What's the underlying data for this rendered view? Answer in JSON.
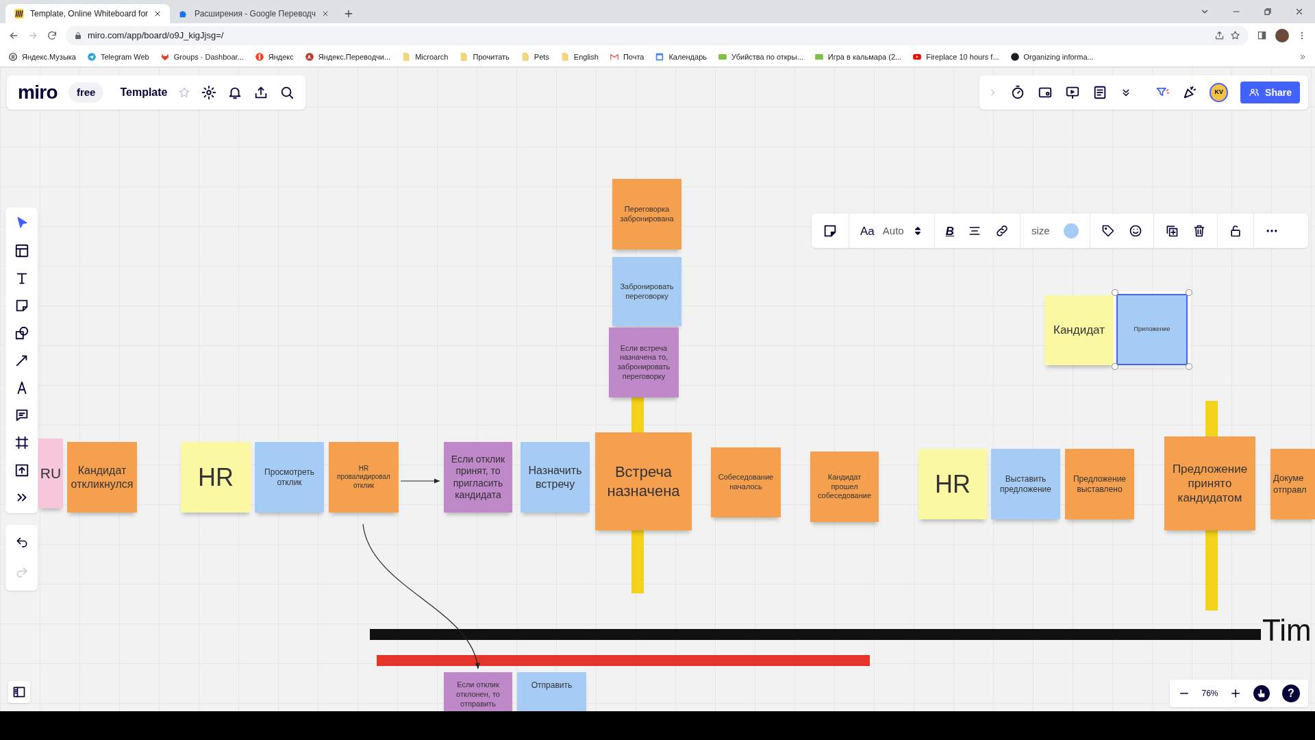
{
  "browser": {
    "tabs": [
      {
        "title": "Template, Online Whiteboard for",
        "selected": true,
        "kind": "miro"
      },
      {
        "title": "Расширения - Google Переводч",
        "selected": false,
        "kind": "puzzle"
      }
    ],
    "address": "miro.com/app/board/o9J_kigJjsg=/",
    "bookmarks": [
      {
        "label": "Яндекс.Музыка",
        "kind": "music"
      },
      {
        "label": "Telegram Web",
        "kind": "telegram"
      },
      {
        "label": "Groups · Dashboar...",
        "kind": "gitlab"
      },
      {
        "label": "Яндекс",
        "kind": "yandex"
      },
      {
        "label": "Яндекс.Переводчи...",
        "kind": "translate"
      },
      {
        "label": "Microarch",
        "kind": "folder"
      },
      {
        "label": "Прочитать",
        "kind": "folder"
      },
      {
        "label": "Pets",
        "kind": "folder"
      },
      {
        "label": "English",
        "kind": "folder"
      },
      {
        "label": "Почта",
        "kind": "gmail"
      },
      {
        "label": "Календарь",
        "kind": "calendar"
      },
      {
        "label": "Убийства по откры...",
        "kind": "hd"
      },
      {
        "label": "Игра в кальмара (2...",
        "kind": "hd"
      },
      {
        "label": "Fireplace 10 hours f...",
        "kind": "youtube"
      },
      {
        "label": "Organizing informa...",
        "kind": "github"
      }
    ]
  },
  "board": {
    "logo": "miro",
    "plan": "free",
    "title": "Template",
    "user_initials": "KV",
    "share": "Share"
  },
  "context_toolbar": {
    "font_glyph": "Aa",
    "font": "Auto",
    "bold_glyph": "B",
    "size": "size",
    "color": "#a6ccf5"
  },
  "zoom": {
    "level_text": "76%",
    "help": "?"
  },
  "stickies": [
    {
      "text": "Переговорка забронирована",
      "color": "#f5a04f",
      "selected": false
    },
    {
      "text": "Забронировать переговорку",
      "color": "#a6ccf5",
      "selected": false
    },
    {
      "text": "Если встреча назначена то, забронировать переговорку",
      "color": "#be88c9",
      "selected": false
    },
    {
      "text": "Кандидат",
      "color": "#fbf8a4",
      "selected": false
    },
    {
      "text": "Приложение",
      "color": "#a6ccf5",
      "selected": true
    },
    {
      "text": "RU",
      "color": "#f7c6da",
      "selected": false
    },
    {
      "text": "Кандидат откликнулся",
      "color": "#f5a04f",
      "selected": false
    },
    {
      "text": "HR",
      "color": "#fbf8a4",
      "selected": false
    },
    {
      "text": "Просмотреть отклик",
      "color": "#a6ccf5",
      "selected": false
    },
    {
      "text": "HR провалидировал отклик",
      "color": "#f5a04f",
      "selected": false
    },
    {
      "text": "Если отклик принят, то пригласить кандидата",
      "color": "#be88c9",
      "selected": false
    },
    {
      "text": "Назначить встречу",
      "color": "#a6ccf5",
      "selected": false
    },
    {
      "text": "Встреча назначена",
      "color": "#f5a04f",
      "selected": false
    },
    {
      "text": "Собеседование началось",
      "color": "#f5a04f",
      "selected": false
    },
    {
      "text": "Кандидат прошел собеседование",
      "color": "#f5a04f",
      "selected": false
    },
    {
      "text": "HR",
      "color": "#fbf8a4",
      "selected": false
    },
    {
      "text": "Выставить предложение",
      "color": "#a6ccf5",
      "selected": false
    },
    {
      "text": "Предложение выставлено",
      "color": "#f5a04f",
      "selected": false
    },
    {
      "text": "Предложение принято кандидатом",
      "color": "#f5a04f",
      "selected": false
    },
    {
      "text": "Докуме отправл",
      "color": "#f5a04f",
      "selected": false
    },
    {
      "text": "Если отклик отклонен, то отправить",
      "color": "#be88c9",
      "selected": false
    },
    {
      "text": "Отправить",
      "color": "#a6ccf5",
      "selected": false
    }
  ],
  "timeline_label": "Tim"
}
